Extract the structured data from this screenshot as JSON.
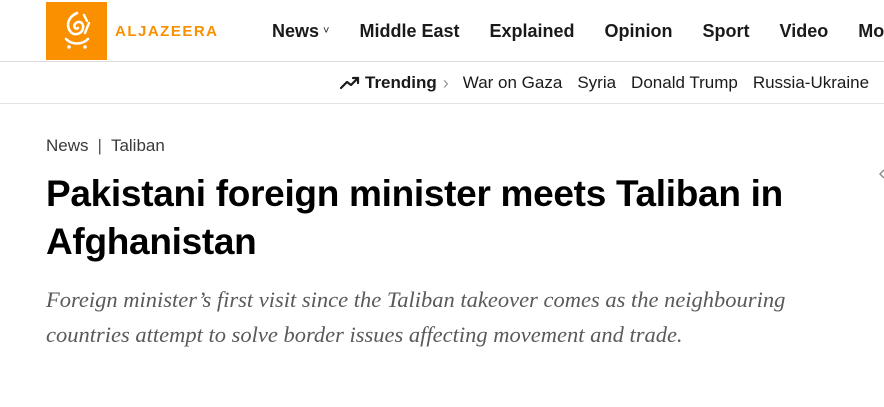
{
  "header": {
    "logo_text": "ALJAZEERA",
    "nav": [
      {
        "label": "News",
        "chevron": "˅"
      },
      {
        "label": "Middle East"
      },
      {
        "label": "Explained"
      },
      {
        "label": "Opinion"
      },
      {
        "label": "Sport"
      },
      {
        "label": "Video"
      },
      {
        "label": "More",
        "chevron": "˅"
      }
    ]
  },
  "trending": {
    "icon": "trending-up-icon",
    "label": "Trending",
    "arrow": "›",
    "links": [
      "War on Gaza",
      "Syria",
      "Donald Trump",
      "Russia-Ukraine"
    ]
  },
  "article": {
    "breadcrumb": [
      "News",
      "Taliban"
    ],
    "breadcrumb_separator": "|",
    "headline": "Pakistani foreign minister meets Taliban in Afghanistan",
    "deck": "Foreign minister’s first visit since the Taliban takeover comes as the neighbouring countries attempt to solve border issues affecting movement and trade."
  },
  "colors": {
    "brand": "#fa9000",
    "text": "#000000",
    "deck": "#5a5a5a"
  }
}
